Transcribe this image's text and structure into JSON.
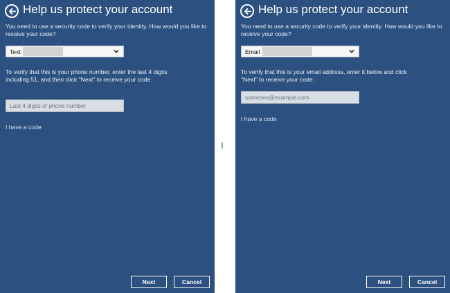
{
  "colors": {
    "panel_background": "#2c5181",
    "field_background": "#d9dee4",
    "select_background": "#f6f6f6",
    "text_light": "#e9eef6"
  },
  "left": {
    "title": "Help us protect your account",
    "intro": "You need to use a security code to verify your identity. How would you like to receive your code?",
    "method": {
      "selected": "Text",
      "icon": "chevron-down-icon"
    },
    "verify_text": "To verify that this is your phone number, enter the last 4 digits including 51, and then click \"Next\" to receive your code.",
    "input": {
      "placeholder": "Last 4 digits of phone number",
      "value": ""
    },
    "have_code": "I have a code",
    "next_label": "Next",
    "cancel_label": "Cancel"
  },
  "right": {
    "title": "Help us protect your account",
    "intro": "You need to use a security code to verify your identity. How would you like to receive your code?",
    "method": {
      "selected": "Email",
      "icon": "chevron-down-icon"
    },
    "verify_text": "To verify that this is your email address, enter it below and click \"Next\" to receive your code.",
    "input": {
      "placeholder": "someone@example.com",
      "value": ""
    },
    "have_code": "I have a code",
    "next_label": "Next",
    "cancel_label": "Cancel"
  }
}
